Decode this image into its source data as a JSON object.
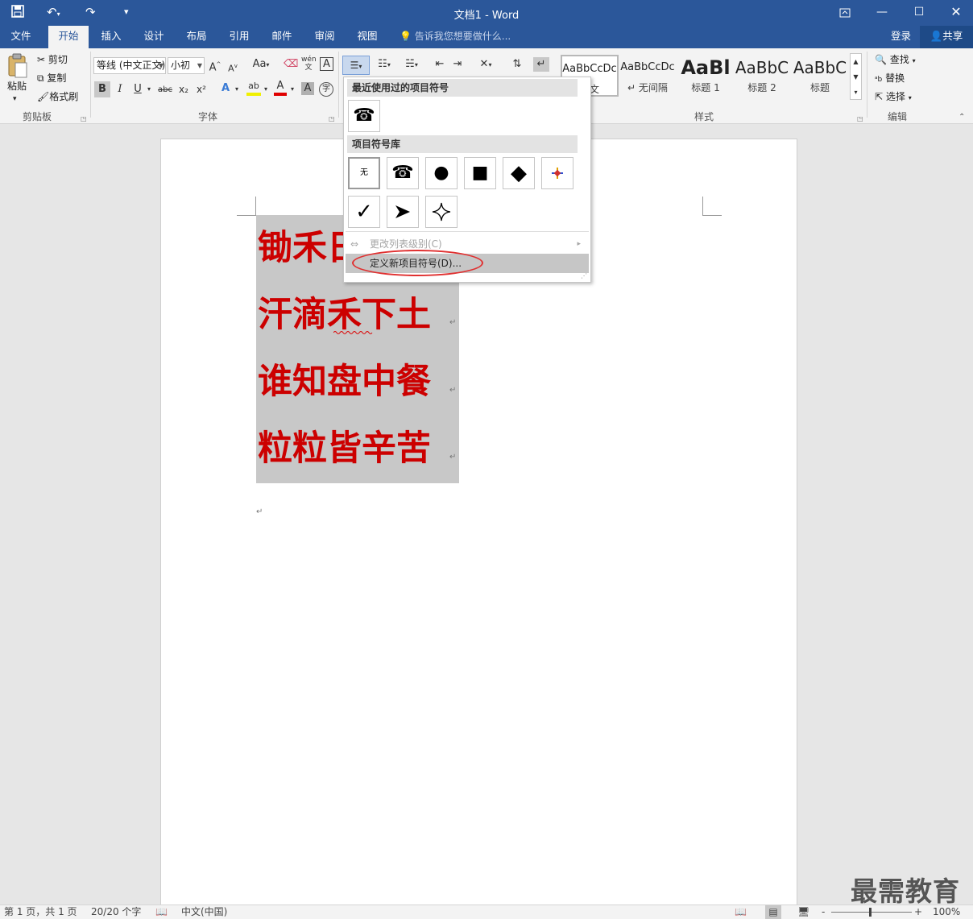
{
  "title_bar": {
    "doc_title": "文档1 - Word"
  },
  "tabs": [
    {
      "label": "文件"
    },
    {
      "label": "开始",
      "active": true
    },
    {
      "label": "插入"
    },
    {
      "label": "设计"
    },
    {
      "label": "布局"
    },
    {
      "label": "引用"
    },
    {
      "label": "邮件"
    },
    {
      "label": "审阅"
    },
    {
      "label": "视图"
    }
  ],
  "tell_me": "告诉我您想要做什么...",
  "account": {
    "login": "登录",
    "share": "共享"
  },
  "clipboard": {
    "paste": "粘贴",
    "cut": "剪切",
    "copy": "复制",
    "format_painter": "格式刷",
    "group_label": "剪贴板"
  },
  "font": {
    "font_name": "等线 (中文正文)",
    "font_size": "小初",
    "group_label": "字体",
    "bold": "B",
    "italic": "I",
    "underline": "U",
    "strike": "abc",
    "subscript": "x₂",
    "superscript": "x²",
    "grow": "A",
    "shrink": "A",
    "case": "Aa",
    "phonetic": "wén",
    "border_char": "A",
    "effects": "A",
    "highlight": "ab",
    "font_color": "A",
    "shading": "A",
    "enclose": "字"
  },
  "styles": {
    "group_label": "样式",
    "items": [
      {
        "preview": "AaBbCcDc",
        "name": "正文"
      },
      {
        "preview": "AaBbCcDc",
        "name": "无间隔"
      },
      {
        "preview": "AaBl",
        "name": "标题 1"
      },
      {
        "preview": "AaBbC",
        "name": "标题 2"
      },
      {
        "preview": "AaBbC",
        "name": "标题"
      }
    ]
  },
  "editing": {
    "find": "查找",
    "replace": "替换",
    "select": "选择",
    "group_label": "编辑"
  },
  "dropdown": {
    "recent_header": "最近使用过的项目符号",
    "library_header": "项目符号库",
    "none_label": "无",
    "change_level": "更改列表级别(C)",
    "define_new": "定义新项目符号(D)..."
  },
  "document": {
    "lines": [
      "锄禾日",
      "汗滴禾下土",
      "谁知盘中餐",
      "粒粒皆辛苦"
    ]
  },
  "status": {
    "page": "第 1 页，共 1 页",
    "words": "20/20 个字",
    "language": "中文(中国)",
    "zoom": "100%"
  },
  "watermark": "最需教育",
  "colors": {
    "accent": "#2b579a",
    "poem_text": "#cc0000",
    "highlight_circle": "#e03030"
  }
}
